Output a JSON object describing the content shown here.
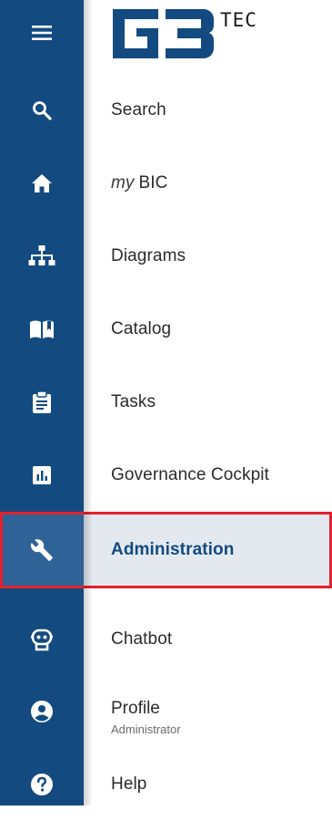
{
  "brand": {
    "logo_letters": "GB",
    "logo_suffix": "TEC",
    "logo_color": "#134a80"
  },
  "menu_toggle": {
    "icon": "hamburger-menu-icon"
  },
  "nav": {
    "items": [
      {
        "id": "search",
        "icon": "search-icon",
        "label": "Search"
      },
      {
        "id": "mybic",
        "icon": "home-icon",
        "prefix": "my",
        "label": "BIC"
      },
      {
        "id": "diagrams",
        "icon": "sitemap-icon",
        "label": "Diagrams"
      },
      {
        "id": "catalog",
        "icon": "open-book-icon",
        "label": "Catalog"
      },
      {
        "id": "tasks",
        "icon": "clipboard-icon",
        "label": "Tasks"
      },
      {
        "id": "governance",
        "icon": "bar-chart-icon",
        "label": "Governance Cockpit"
      },
      {
        "id": "administration",
        "icon": "wrench-icon",
        "label": "Administration",
        "active": true
      },
      {
        "id": "chatbot",
        "icon": "robot-icon",
        "label": "Chatbot"
      },
      {
        "id": "profile",
        "icon": "account-circle-icon",
        "label": "Profile",
        "sublabel": "Administrator"
      },
      {
        "id": "help",
        "icon": "help-circle-icon",
        "label": "Help"
      }
    ]
  },
  "colors": {
    "rail": "#134a80",
    "active_rail": "#2f6398",
    "active_bg": "#e4e9f0",
    "highlight_border": "#e4212c"
  }
}
